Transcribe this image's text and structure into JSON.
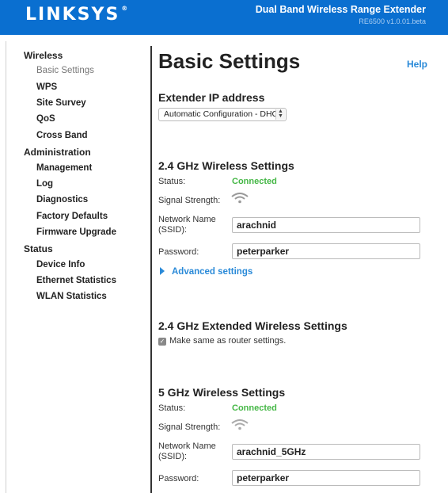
{
  "header": {
    "logo": "LINKSYS",
    "logo_mark": "®",
    "product_name": "Dual Band Wireless Range Extender",
    "version": "RE6500 v1.0.01.beta"
  },
  "sidebar": {
    "sections": [
      {
        "label": "Wireless",
        "items": [
          "Basic Settings",
          "WPS",
          "Site Survey",
          "QoS",
          "Cross Band"
        ]
      },
      {
        "label": "Administration",
        "items": [
          "Management",
          "Log",
          "Diagnostics",
          "Factory Defaults",
          "Firmware Upgrade"
        ]
      },
      {
        "label": "Status",
        "items": [
          "Device Info",
          "Ethernet Statistics",
          "WLAN Statistics"
        ]
      }
    ],
    "active_item": "Basic Settings"
  },
  "main": {
    "title": "Basic Settings",
    "help_label": "Help",
    "extender_ip": {
      "title": "Extender IP address",
      "selected": "Automatic Configuration - DHCP"
    },
    "wifi24": {
      "title": "2.4 GHz Wireless Settings",
      "status_label": "Status:",
      "status_value": "Connected",
      "signal_label": "Signal Strength:",
      "ssid_label_line1": "Network Name",
      "ssid_label_line2": "(SSID):",
      "ssid_value": "arachnid",
      "password_label": "Password:",
      "password_value": "peterparker",
      "advanced_label": "Advanced settings"
    },
    "extended24": {
      "title": "2.4 GHz Extended Wireless Settings",
      "checkbox_label": "Make same as router settings.",
      "checked": true
    },
    "wifi5": {
      "title": "5 GHz Wireless Settings",
      "status_label": "Status:",
      "status_value": "Connected",
      "signal_label": "Signal Strength:",
      "ssid_label_line1": "Network Name",
      "ssid_label_line2": "(SSID):",
      "ssid_value": "arachnid_5GHz",
      "password_label": "Password:",
      "password_value": "peterparker"
    }
  },
  "colors": {
    "header_blue": "#0a6fd0",
    "link_blue": "#2a8ad8",
    "status_green": "#45b746"
  }
}
